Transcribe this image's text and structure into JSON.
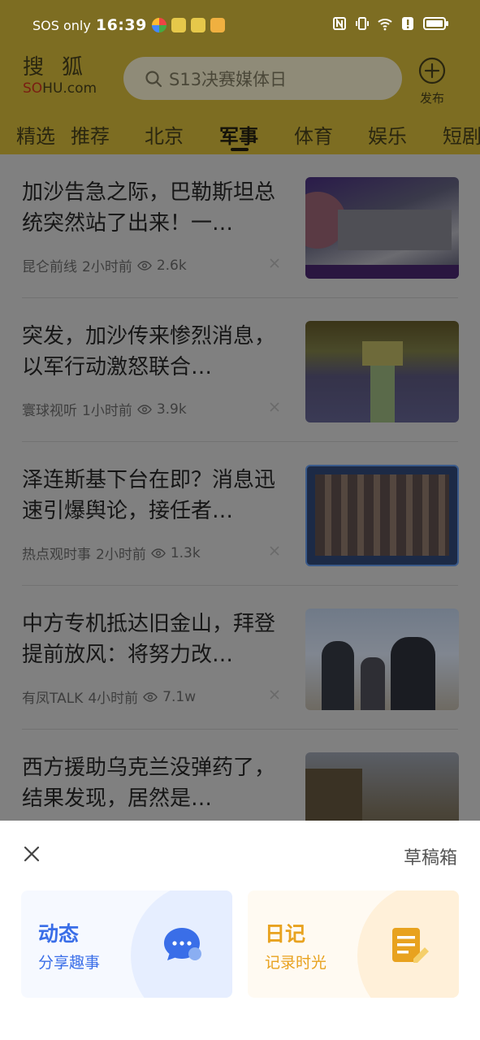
{
  "status_bar": {
    "carrier": "SOS only",
    "time": "16:39"
  },
  "header": {
    "logo_top": "搜狐",
    "logo_bottom_red": "SO",
    "logo_bottom": "HU.com",
    "search_placeholder": "S13决赛媒体日",
    "publish_label": "发布"
  },
  "tabs": [
    {
      "label": "精选"
    },
    {
      "label": "推荐"
    },
    {
      "label": "北京"
    },
    {
      "label": "军事",
      "active": true
    },
    {
      "label": "体育"
    },
    {
      "label": "娱乐"
    },
    {
      "label": "短剧"
    }
  ],
  "feed": [
    {
      "title": "加沙告急之际，巴勒斯坦总统突然站了出来！一…",
      "source": "昆仑前线",
      "time": "2小时前",
      "views": "2.6k",
      "thumb": "room"
    },
    {
      "title": "突发，加沙传来惨烈消息，以军行动激怒联合…",
      "source": "寰球视听",
      "time": "1小时前",
      "views": "3.9k",
      "thumb": "assembly"
    },
    {
      "title": "泽连斯基下台在即？消息迅速引爆舆论，接任者…",
      "source": "热点观时事",
      "time": "2小时前",
      "views": "1.3k",
      "thumb": "soldiers"
    },
    {
      "title": "中方专机抵达旧金山，拜登提前放风：将努力改…",
      "source": "有凤TALK",
      "time": "4小时前",
      "views": "7.1w",
      "thumb": "airport"
    },
    {
      "title": "西方援助乌克兰没弹药了，结果发现，居然是…",
      "source": "",
      "time": "",
      "views": "",
      "thumb": "field"
    }
  ],
  "sheet": {
    "drafts": "草稿箱",
    "cards": [
      {
        "title": "动态",
        "subtitle": "分享趣事",
        "icon": "chat-bubble-icon",
        "color": "#3a6ee8"
      },
      {
        "title": "日记",
        "subtitle": "记录时光",
        "icon": "diary-edit-icon",
        "color": "#e8a21f"
      }
    ]
  },
  "colors": {
    "brand_yellow": "#f5d84a",
    "overlay_dim": "#808080",
    "sheet_blue": "#3a6ee8",
    "sheet_orange": "#e8a21f"
  }
}
